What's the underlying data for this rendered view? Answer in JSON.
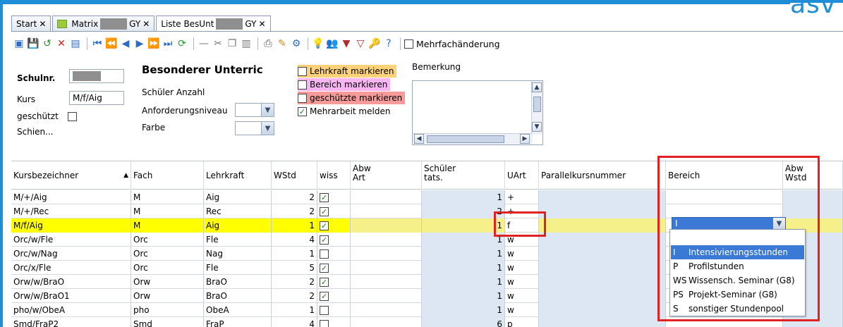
{
  "brand": "asv",
  "tabs": [
    {
      "label": "Start",
      "active": false,
      "redacted": false
    },
    {
      "label_left": "Matrix",
      "label_right": "GY",
      "active": false,
      "redacted": true,
      "icon": "document-icon"
    },
    {
      "label_left": "Liste BesUnt",
      "label_right": "GY",
      "active": true,
      "redacted": true
    }
  ],
  "toolbar": {
    "mehrfach_label": "Mehrfachänderung"
  },
  "form": {
    "schulnr_label": "Schulnr.",
    "kurs_label": "Kurs",
    "kurs_value": "M/f/Aig",
    "geschuetzt_label": "geschützt",
    "schien_label": "Schien...",
    "title": "Besonderer Unterric",
    "schueler_anzahl_label": "Schüler Anzahl",
    "anforderung_label": "Anforderungsniveau",
    "farbe_label": "Farbe",
    "legend": [
      {
        "label": "Lehrkraft markieren",
        "checked": false,
        "color": "#ffd27a"
      },
      {
        "label": "Bereich markieren",
        "checked": false,
        "color": "#f7b6f1"
      },
      {
        "label": "geschützte markieren",
        "checked": false,
        "color": "#f79a9a"
      },
      {
        "label": "Mehrarbeit melden",
        "checked": true,
        "color": "#ffffff"
      }
    ],
    "bemerkung_label": "Bemerkung"
  },
  "grid": {
    "headers": [
      {
        "label": "Kursbezeichner",
        "sort": "▲"
      },
      {
        "label": "Fach"
      },
      {
        "label": "Lehrkraft"
      },
      {
        "label": "WStd"
      },
      {
        "label": "wiss"
      },
      {
        "label": "Abw\nArt"
      },
      {
        "label": "Schüler\ntats."
      },
      {
        "label": "UArt"
      },
      {
        "label": "Parallelkursnummer"
      },
      {
        "label": "Bereich"
      },
      {
        "label": "Abw\nWstd"
      }
    ],
    "rows": [
      {
        "kurs": "M/+/Aig",
        "fach": "M",
        "lk": "Aig",
        "wstd": "2",
        "wiss": true,
        "schueler": "1",
        "uart": "+",
        "style": "normal"
      },
      {
        "kurs": "M/+/Rec",
        "fach": "M",
        "lk": "Rec",
        "wstd": "2",
        "wiss": true,
        "schueler": "2",
        "uart": "+",
        "style": "normal"
      },
      {
        "kurs": "M/f/Aig",
        "fach": "M",
        "lk": "Aig",
        "wstd": "1",
        "wiss": true,
        "schueler": "1",
        "uart": "f",
        "style": "selected"
      },
      {
        "kurs": "Orc/w/Fle",
        "fach": "Orc",
        "lk": "Fle",
        "wstd": "4",
        "wiss": true,
        "schueler": "1",
        "uart": "w",
        "style": "normal"
      },
      {
        "kurs": "Orc/w/Nag",
        "fach": "Orc",
        "lk": "Nag",
        "wstd": "1",
        "wiss": false,
        "schueler": "1",
        "uart": "w",
        "style": "normal"
      },
      {
        "kurs": "Orc/x/Fle",
        "fach": "Orc",
        "lk": "Fle",
        "wstd": "5",
        "wiss": true,
        "schueler": "1",
        "uart": "w",
        "style": "normal"
      },
      {
        "kurs": "Orw/w/BraO",
        "fach": "Orw",
        "lk": "BraO",
        "wstd": "2",
        "wiss": true,
        "schueler": "1",
        "uart": "w",
        "style": "normal"
      },
      {
        "kurs": "Orw/w/BraO1",
        "fach": "Orw",
        "lk": "BraO",
        "wstd": "2",
        "wiss": true,
        "schueler": "1",
        "uart": "w",
        "style": "normal"
      },
      {
        "kurs": "pho/w/ObeA",
        "fach": "pho",
        "lk": "ObeA",
        "wstd": "1",
        "wiss": false,
        "schueler": "1",
        "uart": "w",
        "style": "normal"
      },
      {
        "kurs": "Smd/FraP2",
        "fach": "Smd",
        "lk": "FraP",
        "wstd": "4",
        "wiss": false,
        "schueler": "6",
        "uart": "p",
        "style": "normal"
      }
    ]
  },
  "dropdown": {
    "selected_value": "I",
    "options": [
      {
        "code": "I",
        "label": "Intensivierungsstunden",
        "selected": true
      },
      {
        "code": "P",
        "label": "Profilstunden",
        "selected": false
      },
      {
        "code": "WS",
        "label": "Wissensch. Seminar (G8)",
        "selected": false
      },
      {
        "code": "PS",
        "label": "Projekt-Seminar (G8)",
        "selected": false
      },
      {
        "code": "S",
        "label": "sonstiger Stundenpool",
        "selected": false
      }
    ]
  }
}
